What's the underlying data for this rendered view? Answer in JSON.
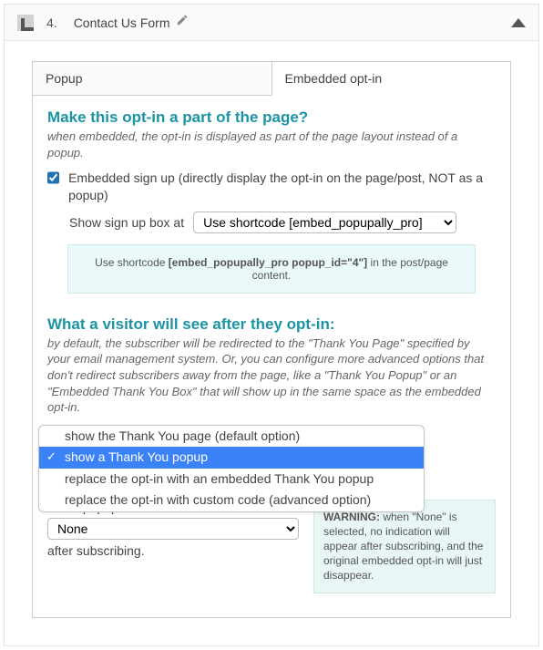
{
  "header": {
    "step": "4.",
    "title": "Contact Us Form"
  },
  "tabs": {
    "popup": "Popup",
    "embedded": "Embedded opt-in"
  },
  "section1": {
    "title": "Make this opt-in a part of the page?",
    "sub": "when embedded, the opt-in is displayed as part of the page layout instead of a popup.",
    "chk_label": "Embedded sign up (directly display the opt-in on the page/post, NOT as a popup)",
    "show_box_label": "Show sign up box at",
    "show_box_value": "Use shortcode [embed_popupally_pro]",
    "note_pre": "Use shortcode ",
    "note_code": "[embed_popupally_pro popup_id=\"4\"]",
    "note_post": " in the post/page content."
  },
  "section2": {
    "title": "What a visitor will see after they opt-in:",
    "sub": "by default, the subscriber will be redirected to the \"Thank You Page\" specified by your email management system. Or, you can configure more advanced options that don't redirect subscribers away from the page, like a \"Thank You Popup\" or an \"Embedded Thank You Box\" that will show up in the same space as the embedded opt-in.",
    "options": [
      "show the Thank You page (default option)",
      "show a Thank You popup",
      "replace the opt-in with an embedded Thank You popup",
      "replace the opt-in with custom code (advanced option)"
    ],
    "show_popup_label": "Show popup",
    "show_popup_value": "None",
    "after_text": "after subscribing.",
    "warn_label": "WARNING:",
    "warn_text": " when \"None\" is selected, no indication will appear after subscribing, and the original embedded opt-in will just disappear."
  }
}
